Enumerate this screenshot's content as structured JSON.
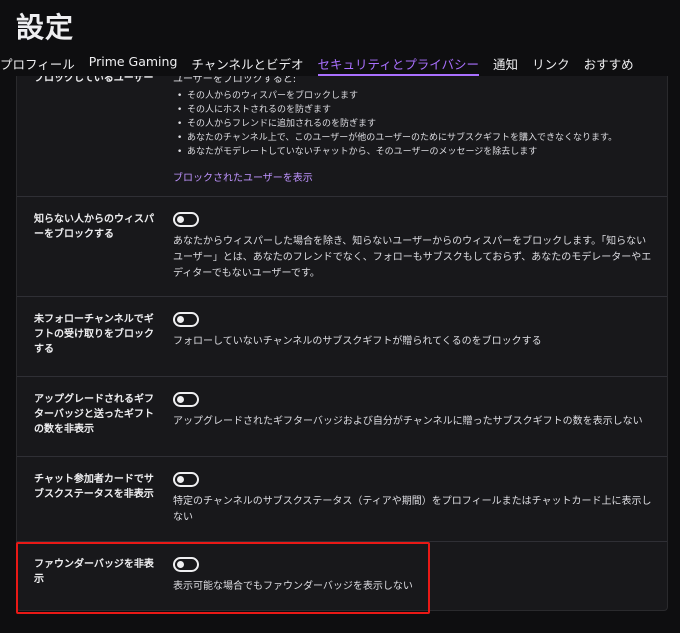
{
  "page": {
    "title": "設定"
  },
  "tabs": [
    {
      "label": "プロフィール"
    },
    {
      "label": "Prime Gaming"
    },
    {
      "label": "チャンネルとビデオ"
    },
    {
      "label": "セキュリティとプライバシー"
    },
    {
      "label": "通知"
    },
    {
      "label": "リンク"
    },
    {
      "label": "おすすめ"
    }
  ],
  "active_tab": "セキュリティとプライバシー",
  "blocked_users": {
    "label": "ブロックしているユーザー",
    "intro": "ユーザーをブロックすると:",
    "bullets": [
      "その人からのウィスパーをブロックします",
      "その人にホストされるのを防ぎます",
      "その人からフレンドに追加されるのを防ぎます",
      "あなたのチャンネル上で、このユーザーが他のユーザーのためにサブスクギフトを購入できなくなります。",
      "あなたがモデレートしていないチャットから、そのユーザーのメッセージを除去します"
    ],
    "link": "ブロックされたユーザーを表示"
  },
  "settings": [
    {
      "label": "知らない人からのウィスパーをブロックする",
      "toggle_on": false,
      "description": "あなたからウィスパーした場合を除き、知らないユーザーからのウィスパーをブロックします。「知らないユーザー」とは、あなたのフレンドでなく、フォローもサブスクもしておらず、あなたのモデレーターやエディターでもないユーザーです。"
    },
    {
      "label": "未フォローチャンネルでギフトの受け取りをブロックする",
      "toggle_on": false,
      "description": "フォローしていないチャンネルのサブスクギフトが贈られてくるのをブロックする"
    },
    {
      "label": "アップグレードされるギフターバッジと送ったギフトの数を非表示",
      "toggle_on": false,
      "description": "アップグレードされたギフターバッジおよび自分がチャンネルに贈ったサブスクギフトの数を表示しない"
    },
    {
      "label": "チャット参加者カードでサブスクステータスを非表示",
      "toggle_on": false,
      "description": "特定のチャンネルのサブスクステータス（ティアや期間）をプロフィールまたはチャットカード上に表示しない"
    },
    {
      "label": "ファウンダーバッジを非表示",
      "toggle_on": false,
      "description": "表示可能な場合でもファウンダーバッジを表示しない"
    }
  ],
  "colors": {
    "accent": "#a970ff",
    "highlight": "#e91916",
    "background": "#0e0e10",
    "card": "#18181b"
  }
}
